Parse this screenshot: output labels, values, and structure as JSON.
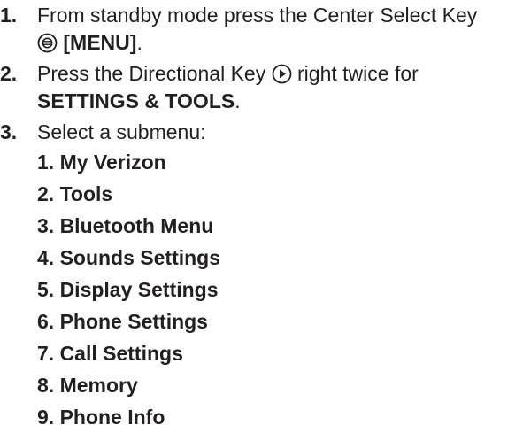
{
  "steps": [
    {
      "number": "1.",
      "text_before_icon": "From standby mode press the Center Select Key",
      "icon": "center-select-key-icon",
      "bold_after_icon": "[MENU]",
      "text_end": "."
    },
    {
      "number": "2.",
      "text_before_icon": "Press the Directional Key",
      "icon": "directional-key-right-icon",
      "text_after_icon": "right twice for",
      "bold_text": "SETTINGS & TOOLS",
      "text_end": "."
    },
    {
      "number": "3.",
      "text": "Select a submenu:"
    }
  ],
  "submenu": [
    "1. My Verizon",
    "2. Tools",
    "3. Bluetooth Menu",
    "4. Sounds Settings",
    "5. Display Settings",
    "6. Phone Settings",
    "7. Call Settings",
    "8. Memory",
    "9. Phone Info"
  ]
}
